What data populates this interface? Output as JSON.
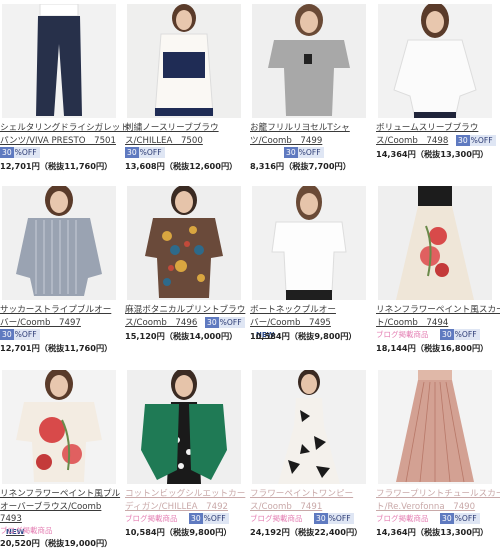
{
  "products": [
    {
      "title_lines": [
        "シェルタリングドライシガレット",
        "パンツ/VIVA PRESTO　7501"
      ],
      "off_num": "30",
      "off_text": "%OFF",
      "price": "12,701円（税抜11,760円）",
      "colors": {
        "bg": "#f2f2f2",
        "top": "#ffffff",
        "bottom": "#27304a",
        "hair": "#3a2a22"
      }
    },
    {
      "title_lines": [
        "刺繍ノースリーブブラウ",
        "ス/CHILLEA　7500"
      ],
      "off_num": "30",
      "off_text": "%OFF",
      "price": "13,608円（税抜12,600円）",
      "colors": {
        "bg": "#efefee",
        "top": "#faf8f4",
        "bottom": "#f4f1ec",
        "hair": "#5a3b2a"
      }
    },
    {
      "title_lines": [
        "お籠フリルリヨセルTシャ",
        "ツ/Coomb　7499"
      ],
      "off_num": "30",
      "off_text": "%OFF",
      "price": "8,316円（税抜7,700円）",
      "colors": {
        "bg": "#efefef",
        "top": "#a8a8a8",
        "bottom": "#d8d8d8",
        "hair": "#6a4a36"
      }
    },
    {
      "title_lines": [
        "ボリュームスリーブブラウ",
        "ス/Coomb　7498"
      ],
      "off_num": "30",
      "off_text": "%OFF",
      "price": "14,364円（税抜13,300円）",
      "colors": {
        "bg": "#f2f2f2",
        "top": "#fbfbfb",
        "bottom": "#20243a",
        "hair": "#5a3b2a"
      }
    },
    {
      "title_lines": [
        "サッカーストライプブルオー",
        "バー/Coomb　7497"
      ],
      "off_num": "30",
      "off_text": "%OFF",
      "price": "12,701円（税抜11,760円）",
      "colors": {
        "bg": "#f0f0f0",
        "top": "#9aa3b2",
        "bottom": "#cfd3da",
        "hair": "#5a3b2a"
      }
    },
    {
      "title_lines": [
        "麻混ボタニカルプリントブラウ",
        "ス/Coomb　7496"
      ],
      "off_num": "30",
      "off_text": "%OFF",
      "price": "15,120円（税抜14,000円）",
      "colors": {
        "bg": "#eeeeee",
        "top": "#6a4a3a",
        "bottom": "#2a3a5a",
        "hair": "#3a2a22"
      }
    },
    {
      "title_lines": [
        "ボートネックプルオー",
        "バー/Coomb　7495"
      ],
      "new": "NEW",
      "price": "10,584円（税抜9,800円）",
      "colors": {
        "bg": "#f1f1f1",
        "top": "#fdfdfd",
        "bottom": "#1f1f1f",
        "hair": "#6a4a36"
      }
    },
    {
      "title_lines": [
        "リネンフラワーペイント風スカー",
        "ト/Coomb　7494"
      ],
      "blog": "ブログ掲載商品",
      "off_num": "30",
      "off_text": "%OFF",
      "price": "18,144円（税抜16,800円）",
      "colors": {
        "bg": "#efefef",
        "top": "#1c1c1c",
        "bottom": "#efe6d8",
        "hair": "#3a2a22"
      }
    },
    {
      "title_lines": [
        "リネンフラワーペイント風プル",
        "オーバーブラウス/Coomb",
        "7493"
      ],
      "new": "NEW",
      "blog": "ブログ掲載商品",
      "price": "20,520円（税抜19,000円）",
      "colors": {
        "bg": "#f3f3f3",
        "top": "#f3ece2",
        "bottom": "#f3ece2",
        "hair": "#5a3b2a"
      }
    },
    {
      "title_lines": [
        "コットンビッグシルエットカー",
        "ディガン/CHILLEA　7492"
      ],
      "pink": true,
      "blog": "ブログ掲載商品",
      "off_num": "30",
      "off_text": "%OFF",
      "price": "10,584円（税抜9,800円）",
      "colors": {
        "bg": "#efefef",
        "top": "#1f7a55",
        "bottom": "#1a1a1a",
        "hair": "#3a2a22"
      }
    },
    {
      "title_lines": [
        "フラワーペイントワンピー",
        "ス/Coomb　7491"
      ],
      "pink": true,
      "blog": "ブログ掲載商品",
      "off_num": "30",
      "off_text": "%OFF",
      "price": "24,192円（税抜22,400円）",
      "colors": {
        "bg": "#f1f1f1",
        "top": "#f4f1ec",
        "bottom": "#f4f1ec",
        "hair": "#3a2a22"
      }
    },
    {
      "title_lines": [
        "フラワープリントチュールスカー",
        "ト/Re.Verofonna　7490"
      ],
      "pink": true,
      "blog": "ブログ掲載商品",
      "off_num": "30",
      "off_text": "%OFF",
      "price": "14,364円（税抜13,300円）",
      "colors": {
        "bg": "#f3f3f3",
        "top": "#e0b8a8",
        "bottom": "#cf9888",
        "hair": "#cf9888"
      }
    }
  ]
}
